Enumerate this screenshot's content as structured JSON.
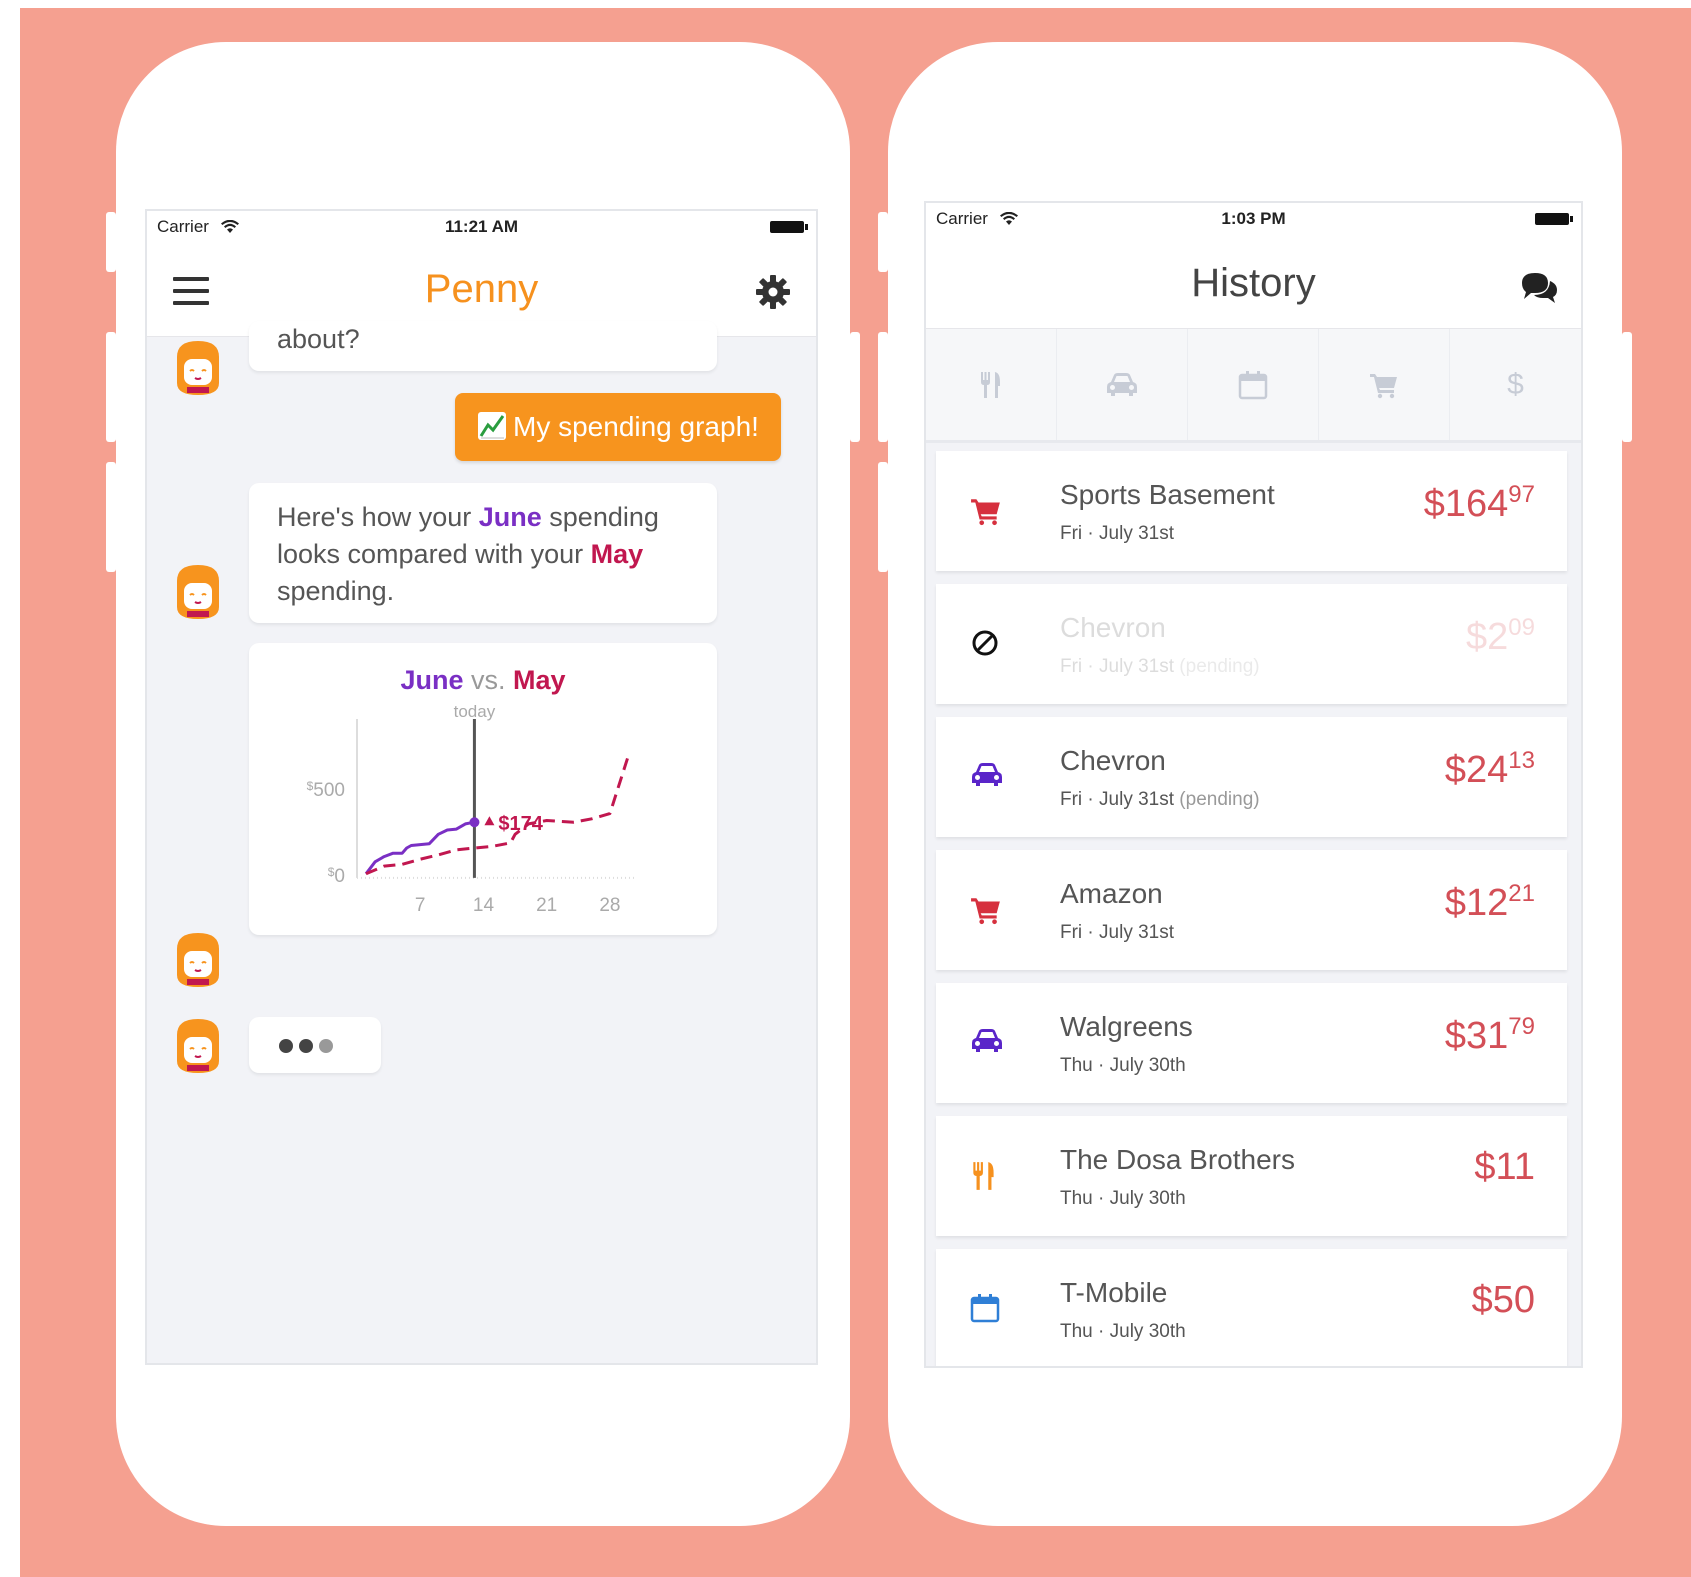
{
  "left_phone": {
    "status": {
      "carrier": "Carrier",
      "time": "11:21 AM"
    },
    "nav_title": "Penny",
    "messages": {
      "prev_text": "about?",
      "user_reply": "My spending graph!",
      "bot_line1_a": "Here's how your ",
      "bot_line1_june": "June",
      "bot_line1_b": " spending",
      "bot_line2_a": "looks compared with your ",
      "bot_line2_may": "May",
      "bot_line3": "spending."
    }
  },
  "chart_data": {
    "type": "line",
    "title_june": "June",
    "title_vs": " vs. ",
    "title_may": "May",
    "marker_label": "today",
    "today_day": 13,
    "today_value_label": "$174",
    "x_ticks": [
      "7",
      "14",
      "21",
      "28"
    ],
    "x_tick_values": [
      7,
      14,
      21,
      28
    ],
    "y_ticks": [
      {
        "value": 0,
        "prefix": "$",
        "label": "0"
      },
      {
        "value": 500,
        "prefix": "$",
        "label": "500"
      }
    ],
    "xlim": [
      0,
      31
    ],
    "ylim": [
      -30,
      900
    ],
    "series": [
      {
        "name": "June",
        "color": "#7a2fc4",
        "style": "solid",
        "points": [
          [
            1,
            0
          ],
          [
            2,
            70
          ],
          [
            3,
            100
          ],
          [
            4,
            120
          ],
          [
            5,
            120
          ],
          [
            5.5,
            150
          ],
          [
            6,
            165
          ],
          [
            7,
            170
          ],
          [
            8,
            175
          ],
          [
            9,
            230
          ],
          [
            10,
            255
          ],
          [
            11,
            260
          ],
          [
            12,
            290
          ],
          [
            13,
            300
          ]
        ]
      },
      {
        "name": "May",
        "color": "#c1174f",
        "style": "dashed",
        "points": [
          [
            1,
            0
          ],
          [
            3,
            45
          ],
          [
            5,
            55
          ],
          [
            7,
            85
          ],
          [
            9,
            110
          ],
          [
            11,
            140
          ],
          [
            13,
            150
          ],
          [
            15,
            160
          ],
          [
            17,
            180
          ],
          [
            17.5,
            230
          ],
          [
            19,
            290
          ],
          [
            21,
            310
          ],
          [
            24,
            300
          ],
          [
            26,
            320
          ],
          [
            28,
            350
          ],
          [
            30,
            680
          ]
        ]
      }
    ]
  },
  "right_phone": {
    "status": {
      "carrier": "Carrier",
      "time": "1:03 PM"
    },
    "nav_title": "History",
    "categories": [
      "fork-knife",
      "car",
      "calendar",
      "cart",
      "dollar"
    ],
    "dollar_glyph": "$",
    "transactions": [
      {
        "name": "Sports Basement",
        "date": "Fri · July 31st",
        "pending": "",
        "dollars": "$164",
        "cents": "97",
        "icon": "cart",
        "color": "#d6303e",
        "faded": false
      },
      {
        "name": "Chevron",
        "date": "Fri · July 31st",
        "pending": " (pending)",
        "dollars": "$2",
        "cents": "09",
        "icon": "block",
        "color": "#111111",
        "faded": true
      },
      {
        "name": "Chevron",
        "date": "Fri · July 31st",
        "pending": " (pending)",
        "dollars": "$24",
        "cents": "13",
        "icon": "car",
        "color": "#5a25c9",
        "faded": false
      },
      {
        "name": "Amazon",
        "date": "Fri · July 31st",
        "pending": "",
        "dollars": "$12",
        "cents": "21",
        "icon": "cart",
        "color": "#d6303e",
        "faded": false
      },
      {
        "name": "Walgreens",
        "date": "Thu · July 30th",
        "pending": "",
        "dollars": "$31",
        "cents": "79",
        "icon": "car",
        "color": "#5a25c9",
        "faded": false
      },
      {
        "name": "The Dosa Brothers",
        "date": "Thu · July 30th",
        "pending": "",
        "dollars": "$11",
        "cents": "",
        "icon": "fork-knife",
        "color": "#f6911e",
        "faded": false
      },
      {
        "name": "T-Mobile",
        "date": "Thu · July 30th",
        "pending": "",
        "dollars": "$50",
        "cents": "",
        "icon": "calendar",
        "color": "#2f7fd6",
        "faded": false
      }
    ]
  },
  "colors": {
    "backdrop": "#f5a090",
    "penny_orange": "#f6911e",
    "june_purple": "#7a2fc4",
    "may_red": "#c1174f",
    "amount_red": "#d34f57"
  }
}
